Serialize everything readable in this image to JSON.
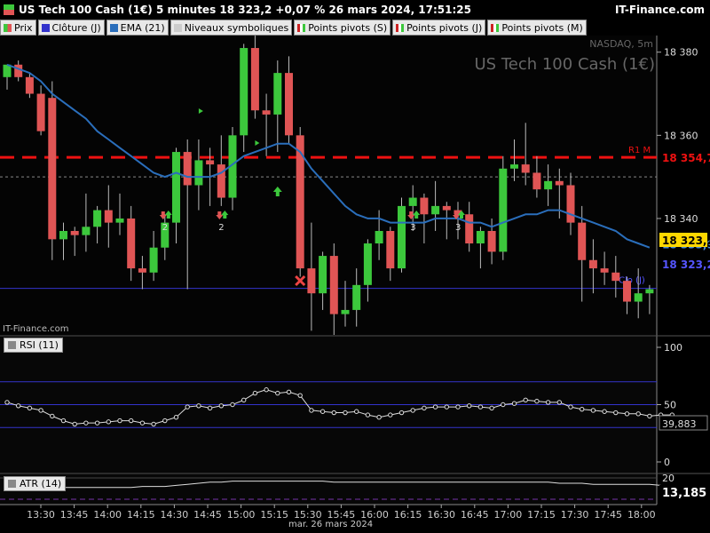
{
  "header": {
    "title": "US Tech 100 Cash (1€) 5 minutes 18 323,2 +0,07 % 26 mars 2024, 17:51:25",
    "brand": "IT-Finance.com"
  },
  "legend": [
    {
      "label": "Prix",
      "color": "#3cb44b"
    },
    {
      "label": "Clôture (J)",
      "color": "#3333cc"
    },
    {
      "label": "EMA (21)",
      "color": "#2a6ebb"
    },
    {
      "label": "Niveaux symboliques",
      "color": "#dddddd"
    },
    {
      "label": "Points pivots (S)",
      "color": "#cc2222"
    },
    {
      "label": "Points pivots (J)",
      "color": "#cc2222"
    },
    {
      "label": "Points pivots (M)",
      "color": "#cc2222"
    }
  ],
  "main": {
    "market": "NASDAQ, 5m",
    "instrument": "US Tech 100 Cash (1€)",
    "watermark": "IT-Finance.com",
    "r1_label": "R1 M",
    "clo_label": "Clo (J)",
    "badge_ema": "18 333,9",
    "badge_last": "18 323,2",
    "badge_r1": "18 354,7",
    "badge_clo": "18 323,2"
  },
  "rsi": {
    "label": "RSI (11)",
    "value_label": "39,883"
  },
  "atr": {
    "label": "ATR (14)",
    "value_label": "13,185"
  },
  "x_date_label": "mar. 26 mars 2024",
  "colors": {
    "up": "#3cc83c",
    "down": "#e05555",
    "ema": "#2a6ebb",
    "pivot": "#ee1111",
    "clo": "#3333cc"
  },
  "chart_data": {
    "type": "candlestick",
    "timeframe": "5m",
    "x_tick_labels": [
      "13:30",
      "13:45",
      "14:00",
      "14:15",
      "14:30",
      "14:45",
      "15:00",
      "15:15",
      "15:30",
      "15:45",
      "16:00",
      "16:15",
      "16:30",
      "16:45",
      "17:00",
      "17:15",
      "17:30",
      "17:45",
      "18:00"
    ],
    "y_tick_labels": [
      "18 380",
      "18 360",
      "18 340"
    ],
    "ylim": [
      18312,
      18384
    ],
    "times": [
      "13:20",
      "13:25",
      "13:30",
      "13:35",
      "13:40",
      "13:45",
      "13:50",
      "13:55",
      "14:00",
      "14:05",
      "14:10",
      "14:15",
      "14:20",
      "14:25",
      "14:30",
      "14:35",
      "14:40",
      "14:45",
      "14:50",
      "14:55",
      "15:00",
      "15:05",
      "15:10",
      "15:15",
      "15:20",
      "15:25",
      "15:30",
      "15:35",
      "15:40",
      "15:45",
      "15:50",
      "15:55",
      "16:00",
      "16:05",
      "16:10",
      "16:15",
      "16:20",
      "16:25",
      "16:30",
      "16:35",
      "16:40",
      "16:45",
      "16:50",
      "16:55",
      "17:00",
      "17:05",
      "17:10",
      "17:15",
      "17:20",
      "17:25",
      "17:30",
      "17:35",
      "17:40",
      "17:45",
      "17:50"
    ],
    "candles": [
      [
        18374,
        18377,
        18371,
        18377
      ],
      [
        18377,
        18378,
        18373,
        18374
      ],
      [
        18374,
        18375,
        18369,
        18370
      ],
      [
        18370,
        18372,
        18360,
        18361
      ],
      [
        18369,
        18373,
        18330,
        18335
      ],
      [
        18335,
        18339,
        18330,
        18337
      ],
      [
        18337,
        18338,
        18331,
        18336
      ],
      [
        18336,
        18346,
        18332,
        18338
      ],
      [
        18338,
        18343,
        18334,
        18342
      ],
      [
        18342,
        18348,
        18333,
        18339
      ],
      [
        18339,
        18346,
        18336,
        18340
      ],
      [
        18340,
        18343,
        18325,
        18328
      ],
      [
        18328,
        18331,
        18323,
        18327
      ],
      [
        18327,
        18337,
        18325,
        18333
      ],
      [
        18333,
        18341,
        18330,
        18339
      ],
      [
        18339,
        18357,
        18334,
        18356
      ],
      [
        18356,
        18359,
        18323,
        18348
      ],
      [
        18348,
        18359,
        18342,
        18354
      ],
      [
        18354,
        18357,
        18343,
        18353
      ],
      [
        18353,
        18360,
        18343,
        18345
      ],
      [
        18345,
        18362,
        18342,
        18360
      ],
      [
        18360,
        18382,
        18356,
        18381
      ],
      [
        18381,
        18385,
        18364,
        18366
      ],
      [
        18366,
        18370,
        18355,
        18365
      ],
      [
        18365,
        18378,
        18356,
        18375
      ],
      [
        18375,
        18379,
        18358,
        18360
      ],
      [
        18360,
        18362,
        18326,
        18328
      ],
      [
        18328,
        18339,
        18313,
        18322
      ],
      [
        18322,
        18332,
        18318,
        18331
      ],
      [
        18331,
        18334,
        18312,
        18317
      ],
      [
        18317,
        18325,
        18314,
        18318
      ],
      [
        18318,
        18328,
        18314,
        18324
      ],
      [
        18324,
        18335,
        18320,
        18334
      ],
      [
        18334,
        18342,
        18330,
        18337
      ],
      [
        18337,
        18338,
        18325,
        18328
      ],
      [
        18328,
        18345,
        18327,
        18343
      ],
      [
        18343,
        18348,
        18337,
        18345
      ],
      [
        18345,
        18346,
        18334,
        18341
      ],
      [
        18341,
        18349,
        18337,
        18343
      ],
      [
        18343,
        18344,
        18335,
        18342
      ],
      [
        18342,
        18344,
        18335,
        18341
      ],
      [
        18341,
        18344,
        18332,
        18334
      ],
      [
        18334,
        18338,
        18328,
        18337
      ],
      [
        18337,
        18340,
        18329,
        18332
      ],
      [
        18332,
        18355,
        18330,
        18352
      ],
      [
        18352,
        18359,
        18349,
        18353
      ],
      [
        18353,
        18363,
        18348,
        18351
      ],
      [
        18351,
        18355,
        18345,
        18347
      ],
      [
        18347,
        18353,
        18343,
        18349
      ],
      [
        18349,
        18352,
        18340,
        18348
      ],
      [
        18348,
        18351,
        18336,
        18339
      ],
      [
        18339,
        18343,
        18320,
        18330
      ],
      [
        18330,
        18335,
        18322,
        18328
      ],
      [
        18328,
        18332,
        18324,
        18327
      ],
      [
        18327,
        18331,
        18321,
        18325
      ],
      [
        18325,
        18326,
        18317,
        18320
      ],
      [
        18320,
        18328,
        18316,
        18322
      ],
      [
        18322,
        18324,
        18317,
        18323
      ]
    ],
    "ema21": [
      18377,
      18376,
      18375,
      18373,
      18370,
      18368,
      18366,
      18364,
      18361,
      18359,
      18357,
      18355,
      18353,
      18351,
      18350,
      18351,
      18350,
      18350,
      18350,
      18351,
      18353,
      18355,
      18356,
      18357,
      18358,
      18358,
      18356,
      18352,
      18349,
      18346,
      18343,
      18341,
      18340,
      18340,
      18339,
      18339,
      18339,
      18339,
      18340,
      18340,
      18340,
      18339,
      18339,
      18338,
      18339,
      18340,
      18341,
      18341,
      18342,
      18342,
      18341,
      18340,
      18339,
      18338,
      18337,
      18335,
      18334,
      18333
    ],
    "pivot_R1_M": 18354.7,
    "close_J": 18323.2,
    "last_price": 18323.2,
    "ema_last": 18333.9,
    "rsi_ticks": [
      "100",
      "50",
      "0"
    ],
    "rsi_levels": [
      70,
      50,
      30
    ],
    "rsi": [
      52,
      49,
      47,
      45,
      40,
      36,
      33,
      34,
      34,
      35,
      36,
      36,
      34,
      33,
      36,
      39,
      48,
      49,
      47,
      49,
      50,
      54,
      60,
      63,
      60,
      61,
      58,
      45,
      44,
      43,
      43,
      44,
      41,
      39,
      41,
      43,
      45,
      47,
      48,
      48,
      48,
      49,
      48,
      47,
      50,
      51,
      54,
      53,
      52,
      52,
      48,
      46,
      45,
      44,
      43,
      42,
      42,
      40,
      41,
      41
    ],
    "atr_ticks": [
      "20"
    ],
    "atr": [
      11,
      11,
      11,
      11,
      11,
      11,
      11,
      11,
      11,
      11,
      11,
      11,
      12,
      12,
      12,
      13,
      14,
      15,
      16,
      16,
      17,
      17,
      17,
      17,
      17,
      17,
      17,
      17,
      17,
      16,
      16,
      16,
      16,
      16,
      16,
      16,
      16,
      16,
      16,
      16,
      16,
      16,
      16,
      16,
      16,
      16,
      16,
      16,
      16,
      15,
      15,
      15,
      14,
      14,
      14,
      14,
      14,
      14,
      13
    ],
    "markers": [
      {
        "type": "pair",
        "time": "14:30",
        "label": "2"
      },
      {
        "type": "pair",
        "time": "14:55",
        "label": "2"
      },
      {
        "type": "up",
        "time": "15:20",
        "label": ""
      },
      {
        "type": "cross",
        "time": "15:30",
        "label": ""
      },
      {
        "type": "pair",
        "time": "16:20",
        "label": "3"
      },
      {
        "type": "pair",
        "time": "16:40",
        "label": "3"
      }
    ]
  }
}
